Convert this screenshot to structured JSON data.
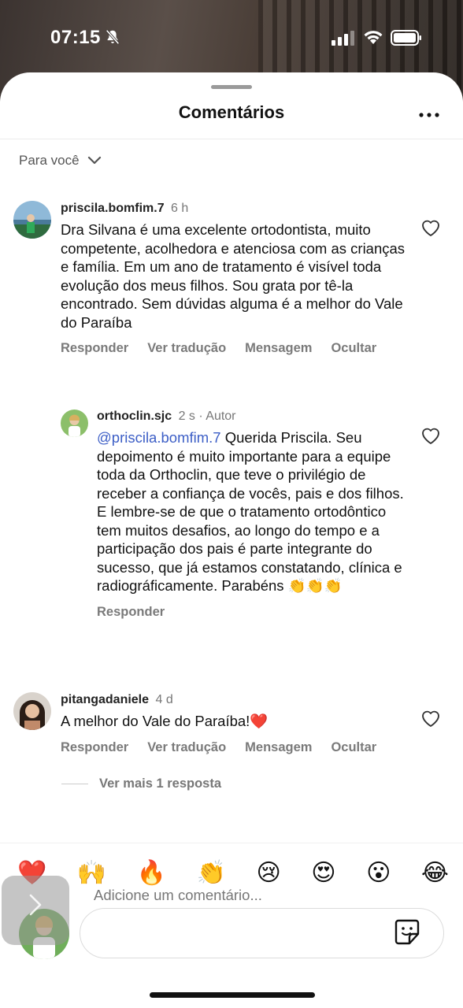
{
  "status_bar": {
    "time": "07:15",
    "icons": [
      "bell-slash-icon",
      "signal-icon",
      "wifi-icon",
      "battery-icon"
    ]
  },
  "sheet": {
    "title": "Comentários",
    "more_icon": "ellipsis-icon",
    "filter_label": "Para você"
  },
  "comments": [
    {
      "username": "priscila.bomfim.7",
      "time": "6 h",
      "text": "Dra Silvana é uma excelente ortodontista, muito competente, acolhedora e atenciosa com as crianças e família. Em um ano de tratamento é visível toda evolução dos meus filhos. Sou grata por tê-la encontrado. Sem dúvidas alguma é a melhor do Vale do Paraíba",
      "actions": [
        "Responder",
        "Ver tradução",
        "Mensagem",
        "Ocultar"
      ]
    },
    {
      "username": "orthoclin.sjc",
      "time": "2 s",
      "author_tag": "· Autor",
      "mention": "@priscila.bomfim.7",
      "text": " Querida Priscila. Seu depoimento é muito importante para a equipe toda da Orthoclin, que teve o privilégio de receber a confiança de vocês, pais e dos filhos. E lembre-se de que o tratamento ortodôntico tem muitos desafios, ao longo do tempo e a participação dos pais é parte integrante do sucesso, que já estamos constatando, clínica e radiográficamente. Parabéns 👏👏👏",
      "actions": [
        "Responder"
      ]
    },
    {
      "username": "pitangadaniele",
      "time": "4 d",
      "text": "A melhor do Vale do Paraíba!❤️",
      "actions": [
        "Responder",
        "Ver tradução",
        "Mensagem",
        "Ocultar"
      ]
    }
  ],
  "more_replies": "Ver mais 1 resposta",
  "emoji_bar": [
    "❤️",
    "🙌",
    "🔥",
    "👏",
    "😢",
    "😍",
    "😮",
    "😂"
  ],
  "composer": {
    "placeholder": "Adicione um comentário...",
    "sticker_icon": "sticker-icon"
  },
  "colors": {
    "mention": "#3c5ec6",
    "heart_red": "#e0161d"
  }
}
